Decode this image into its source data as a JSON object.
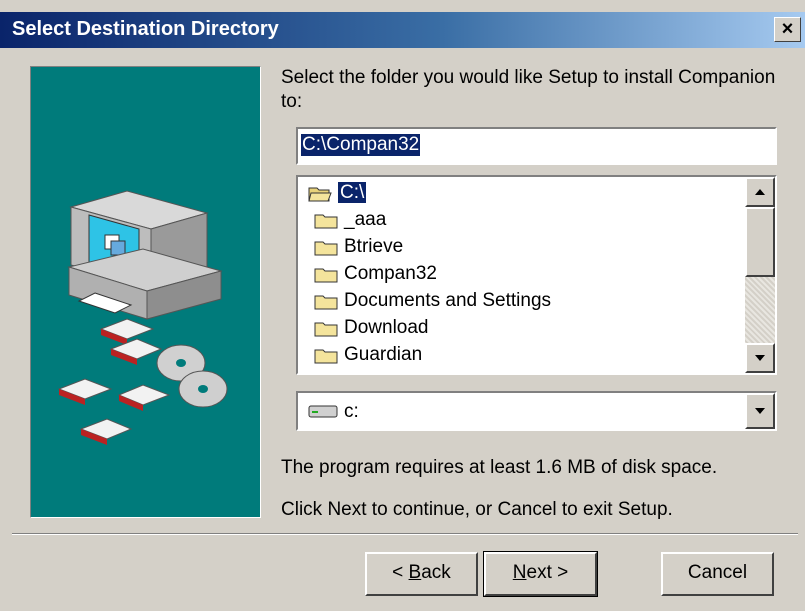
{
  "window": {
    "title": "Select Destination Directory",
    "close_glyph": "×"
  },
  "prompt": "Select the folder you would like Setup to install Companion to:",
  "path_input": {
    "value": "C:\\Compan32"
  },
  "folders": [
    {
      "name": "C:\\",
      "selected": true,
      "open": true
    },
    {
      "name": "_aaa"
    },
    {
      "name": "Btrieve"
    },
    {
      "name": "Compan32"
    },
    {
      "name": "Documents and Settings"
    },
    {
      "name": "Download"
    },
    {
      "name": "Guardian"
    }
  ],
  "drive": {
    "value": "c:",
    "icon": "drive-icon"
  },
  "notes": {
    "space": "The program requires at least 1.6 MB of disk space.",
    "continue": "Click Next to continue, or Cancel to exit Setup."
  },
  "buttons": {
    "back": {
      "prefix": "< ",
      "accel": "B",
      "rest": "ack"
    },
    "next": {
      "accel": "N",
      "rest": "ext >"
    },
    "cancel": "Cancel"
  },
  "colors": {
    "art_bg": "#007b7b",
    "select_bg": "#0a246a"
  }
}
